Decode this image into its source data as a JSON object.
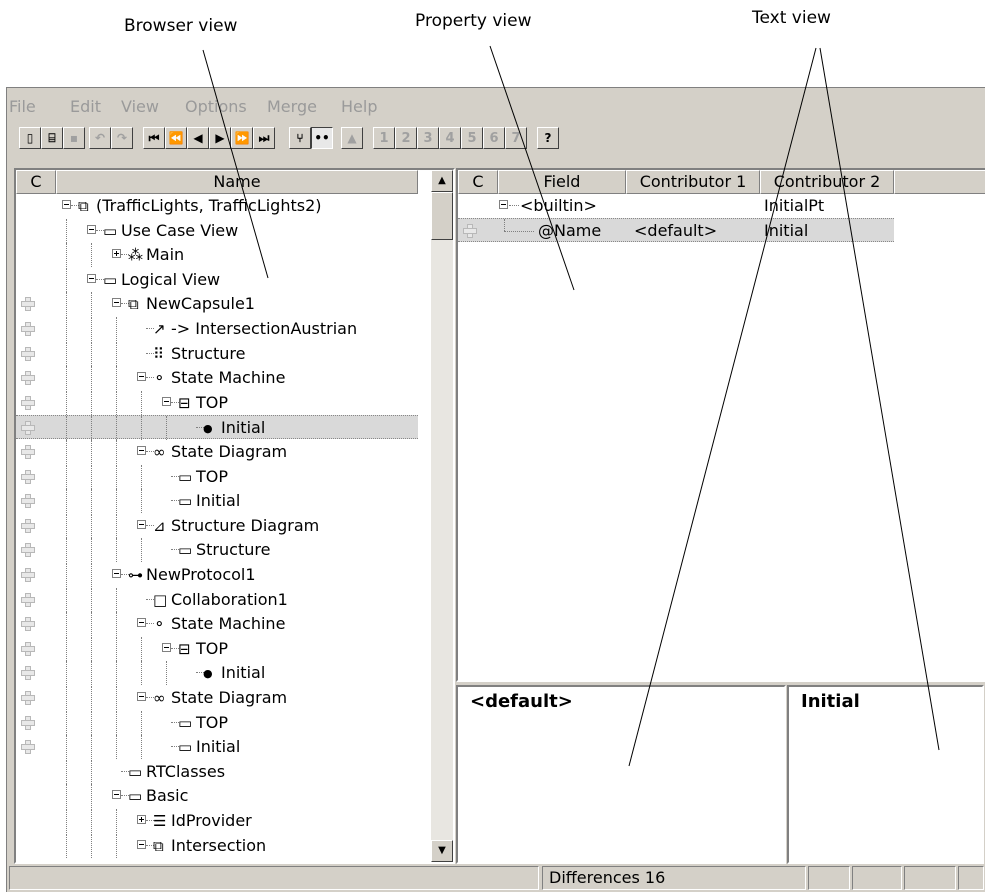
{
  "callouts": {
    "browser": "Browser view",
    "property": "Property view",
    "text": "Text view"
  },
  "menu": [
    "File",
    "Edit",
    "View",
    "Options",
    "Merge",
    "Help"
  ],
  "toolbar": {
    "numbers": [
      "1",
      "2",
      "3",
      "4",
      "5",
      "6",
      "7"
    ],
    "help": "?"
  },
  "tree": {
    "headers": {
      "c": "C",
      "name": "Name"
    },
    "rows": [
      {
        "label": "(TrafficLights, TrafficLights2)",
        "icon": "model-icon",
        "glyph": "⧉"
      },
      {
        "label": "Use Case View",
        "icon": "folder-icon",
        "glyph": "▭"
      },
      {
        "label": "Main",
        "icon": "actors-icon",
        "glyph": "⁂"
      },
      {
        "label": "Logical View",
        "icon": "folder-icon",
        "glyph": "▭"
      },
      {
        "label": "NewCapsule1",
        "icon": "capsule-icon",
        "glyph": "⧉"
      },
      {
        "label": "-> IntersectionAustrian",
        "icon": "generalization-icon",
        "glyph": "↗"
      },
      {
        "label": "Structure",
        "icon": "structure-icon",
        "glyph": "⠿"
      },
      {
        "label": "State Machine",
        "icon": "state-machine-icon",
        "glyph": "⚬"
      },
      {
        "label": "TOP",
        "icon": "state-icon",
        "glyph": "⊟"
      },
      {
        "label": "Initial",
        "icon": "initial-state-icon",
        "glyph": "●"
      },
      {
        "label": "State Diagram",
        "icon": "state-diagram-icon",
        "glyph": "∞"
      },
      {
        "label": "TOP",
        "icon": "diagram-ref-icon",
        "glyph": "▭"
      },
      {
        "label": "Initial",
        "icon": "diagram-ref-icon",
        "glyph": "▭"
      },
      {
        "label": "Structure Diagram",
        "icon": "structure-diagram-icon",
        "glyph": "⊿"
      },
      {
        "label": "Structure",
        "icon": "diagram-ref-icon",
        "glyph": "▭"
      },
      {
        "label": "NewProtocol1",
        "icon": "protocol-icon",
        "glyph": "⊶"
      },
      {
        "label": "Collaboration1",
        "icon": "collaboration-icon",
        "glyph": "□"
      },
      {
        "label": "State Machine",
        "icon": "state-machine-icon",
        "glyph": "⚬"
      },
      {
        "label": "TOP",
        "icon": "state-icon",
        "glyph": "⊟"
      },
      {
        "label": "Initial",
        "icon": "initial-state-icon",
        "glyph": "●"
      },
      {
        "label": "State Diagram",
        "icon": "state-diagram-icon",
        "glyph": "∞"
      },
      {
        "label": "TOP",
        "icon": "diagram-ref-icon",
        "glyph": "▭"
      },
      {
        "label": "Initial",
        "icon": "diagram-ref-icon",
        "glyph": "▭"
      },
      {
        "label": "RTClasses",
        "icon": "folder-icon",
        "glyph": "▭"
      },
      {
        "label": "Basic",
        "icon": "folder-icon",
        "glyph": "▭"
      },
      {
        "label": "IdProvider",
        "icon": "class-icon",
        "glyph": "☰"
      },
      {
        "label": "Intersection",
        "icon": "capsule-icon",
        "glyph": "⧉"
      }
    ]
  },
  "props": {
    "headers": {
      "c": "C",
      "field": "Field",
      "contrib1": "Contributor 1",
      "contrib2": "Contributor 2"
    },
    "rows": [
      {
        "field": "<builtin>",
        "c1": "",
        "c2": "InitialPt"
      },
      {
        "field": "@Name",
        "c1": "<default>",
        "c2": "Initial"
      }
    ]
  },
  "text_view": {
    "left": "<default>",
    "right": "Initial"
  },
  "status": {
    "differences": "Differences 16"
  }
}
